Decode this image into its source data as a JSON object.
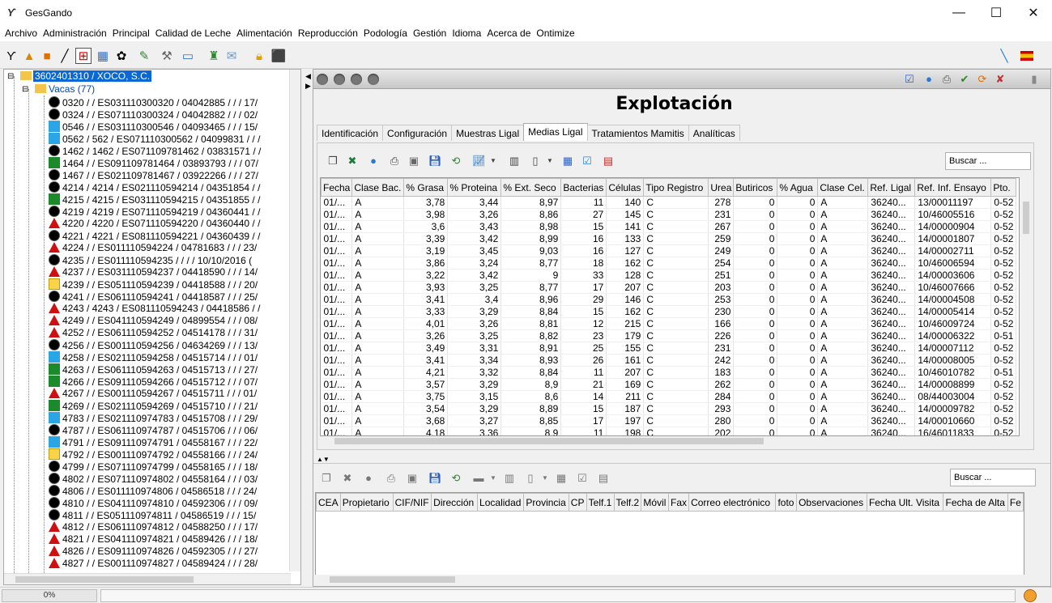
{
  "window": {
    "title": "GesGando",
    "minimize": "—",
    "maximize": "☐",
    "close": "✕"
  },
  "menu": [
    "Archivo",
    "Administración",
    "Principal",
    "Calidad de Leche",
    "Alimentación",
    "Reproducción",
    "Podología",
    "Gestión",
    "Idioma",
    "Acerca de",
    "Ontimize"
  ],
  "tree": {
    "root": "3602401310 / XOCO, S.C.",
    "group": "Vacas (77)",
    "items": [
      {
        "text": "0320 /  /  ES031110300320 / 04042885  /  /  / 17/",
        "icon": "black"
      },
      {
        "text": "0324 /  /  ES071110300324 / 04042882  /  /  / 02/",
        "icon": "black"
      },
      {
        "text": "0546 /  /  ES031110300546 / 04093465  /  /  / 15/",
        "icon": "blue"
      },
      {
        "text": "0562 / 562 / ES071110300562 / 04099831  /  /  / ",
        "icon": "blue"
      },
      {
        "text": "1462 / 1462 / ES071109781462 / 03831571  /  / ",
        "icon": "black"
      },
      {
        "text": "1464 /  /  ES091109781464 / 03893793  /  /  / 07/",
        "icon": "green"
      },
      {
        "text": "1467 /  /  ES021109781467 / 03922266  /  /  / 27/",
        "icon": "black"
      },
      {
        "text": "4214 / 4214 / ES021110594214 / 04351854  /  / ",
        "icon": "black"
      },
      {
        "text": "4215 / 4215 / ES031110594215 / 04351855  /  / ",
        "icon": "green"
      },
      {
        "text": "4219 / 4219 / ES071110594219 / 04360441  /  / ",
        "icon": "black"
      },
      {
        "text": "4220 / 4220 / ES071110594220 / 04360440  /  / ",
        "icon": "red"
      },
      {
        "text": "4221 / 4221 / ES081110594221 / 04360439  /  / ",
        "icon": "black"
      },
      {
        "text": "4224 /  /  ES011110594224 / 04781683  /  /  / 23/",
        "icon": "red"
      },
      {
        "text": "4235 /  /  ES011110594235 /  /  /  / 10/10/2016 (",
        "icon": "black"
      },
      {
        "text": "4237 /  /  ES031110594237 / 04418590  /  /  / 14/",
        "icon": "red"
      },
      {
        "text": "4239 /  /  ES051110594239 / 04418588  /  /  / 20/",
        "icon": "yellow"
      },
      {
        "text": "4241 /  /  ES061110594241 / 04418587  /  /  / 25/",
        "icon": "black"
      },
      {
        "text": "4243 / 4243 / ES081110594243 / 04418586  /  / ",
        "icon": "red"
      },
      {
        "text": "4249 /  /  ES041110594249 / 04899554  /  /  / 08/",
        "icon": "red"
      },
      {
        "text": "4252 /  /  ES061110594252 / 04514178  /  /  / 31/",
        "icon": "red"
      },
      {
        "text": "4256 /  /  ES001110594256 / 04634269  /  /  / 13/",
        "icon": "black"
      },
      {
        "text": "4258 /  /  ES021110594258 / 04515714  /  /  / 01/",
        "icon": "blue"
      },
      {
        "text": "4263 /  /  ES061110594263 / 04515713  /  /  / 27/",
        "icon": "green"
      },
      {
        "text": "4266 /  /  ES091110594266 / 04515712  /  /  / 07/",
        "icon": "green"
      },
      {
        "text": "4267 /  /  ES001110594267 / 04515711  /  /  / 01/",
        "icon": "red"
      },
      {
        "text": "4269 /  /  ES021110594269 / 04515710  /  /  / 21/",
        "icon": "green"
      },
      {
        "text": "4783 /  /  ES021110974783 / 04515708  /  /  / 29/",
        "icon": "blue"
      },
      {
        "text": "4787 /  /  ES061110974787 / 04515706  /  /  / 06/",
        "icon": "black"
      },
      {
        "text": "4791 /  /  ES091110974791 / 04558167  /  /  / 22/",
        "icon": "blue"
      },
      {
        "text": "4792 /  /  ES001110974792 / 04558166  /  /  / 24/",
        "icon": "yellow"
      },
      {
        "text": "4799 /  /  ES071110974799 / 04558165  /  /  / 18/",
        "icon": "black"
      },
      {
        "text": "4802 /  /  ES071110974802 / 04558164  /  /  / 03/",
        "icon": "black"
      },
      {
        "text": "4806 /  /  ES011110974806 / 04586518  /  /  / 24/",
        "icon": "black"
      },
      {
        "text": "4810 /  /  ES041110974810 / 04592306  /  /  / 09/",
        "icon": "black"
      },
      {
        "text": "4811 /  /  ES051110974811 / 04586519  /  /  / 15/",
        "icon": "black"
      },
      {
        "text": "4812 /  /  ES061110974812 / 04588250  /  /  / 17/",
        "icon": "red"
      },
      {
        "text": "4821 /  /  ES041110974821 / 04589426  /  /  / 18/",
        "icon": "red"
      },
      {
        "text": "4826 /  /  ES091110974826 / 04592305  /  /  / 27/",
        "icon": "red"
      },
      {
        "text": "4827 /  /  ES001110974827 / 04589424  /  /  / 28/",
        "icon": "red"
      }
    ]
  },
  "form": {
    "title": "Explotación",
    "tabs": [
      "Identificación",
      "Configuración",
      "Muestras Ligal",
      "Medias Ligal",
      "Tratamientos Mamitis",
      "Analíticas"
    ],
    "active_tab": 3,
    "search_placeholder": "Buscar ...",
    "search2_placeholder": "Buscar ..."
  },
  "grid1": {
    "columns": [
      "Fecha",
      "Clase Bac.",
      "% Grasa",
      "% Proteina",
      "% Ext. Seco",
      "Bacterias",
      "Células",
      "Tipo Registro",
      "Urea",
      "Butiricos",
      "% Agua",
      "Clase Cel.",
      "Ref. Ligal",
      "Ref. Inf. Ensayo",
      "Pto."
    ],
    "rows": [
      [
        "01/...",
        "A",
        "3,78",
        "3,44",
        "8,97",
        "11",
        "140",
        "C",
        "278",
        "0",
        "0",
        "A",
        "36240...",
        "13/00011197",
        "0-52"
      ],
      [
        "01/...",
        "A",
        "3,98",
        "3,26",
        "8,86",
        "27",
        "145",
        "C",
        "231",
        "0",
        "0",
        "A",
        "36240...",
        "10/46005516",
        "0-52"
      ],
      [
        "01/...",
        "A",
        "3,6",
        "3,43",
        "8,98",
        "15",
        "141",
        "C",
        "267",
        "0",
        "0",
        "A",
        "36240...",
        "14/00000904",
        "0-52"
      ],
      [
        "01/...",
        "A",
        "3,39",
        "3,42",
        "8,99",
        "16",
        "133",
        "C",
        "259",
        "0",
        "0",
        "A",
        "36240...",
        "14/00001807",
        "0-52"
      ],
      [
        "01/...",
        "A",
        "3,19",
        "3,45",
        "9,03",
        "16",
        "127",
        "C",
        "249",
        "0",
        "0",
        "A",
        "36240...",
        "14/00002711",
        "0-52"
      ],
      [
        "01/...",
        "A",
        "3,86",
        "3,24",
        "8,77",
        "18",
        "162",
        "C",
        "254",
        "0",
        "0",
        "A",
        "36240...",
        "10/46006594",
        "0-52"
      ],
      [
        "01/...",
        "A",
        "3,22",
        "3,42",
        "9",
        "33",
        "128",
        "C",
        "251",
        "0",
        "0",
        "A",
        "36240...",
        "14/00003606",
        "0-52"
      ],
      [
        "01/...",
        "A",
        "3,93",
        "3,25",
        "8,77",
        "17",
        "207",
        "C",
        "203",
        "0",
        "0",
        "A",
        "36240...",
        "10/46007666",
        "0-52"
      ],
      [
        "01/...",
        "A",
        "3,41",
        "3,4",
        "8,96",
        "29",
        "146",
        "C",
        "253",
        "0",
        "0",
        "A",
        "36240...",
        "14/00004508",
        "0-52"
      ],
      [
        "01/...",
        "A",
        "3,33",
        "3,29",
        "8,84",
        "15",
        "162",
        "C",
        "230",
        "0",
        "0",
        "A",
        "36240...",
        "14/00005414",
        "0-52"
      ],
      [
        "01/...",
        "A",
        "4,01",
        "3,26",
        "8,81",
        "12",
        "215",
        "C",
        "166",
        "0",
        "0",
        "A",
        "36240...",
        "10/46009724",
        "0-52"
      ],
      [
        "01/...",
        "A",
        "3,26",
        "3,25",
        "8,82",
        "23",
        "179",
        "C",
        "226",
        "0",
        "0",
        "A",
        "36240...",
        "14/00006322",
        "0-51"
      ],
      [
        "01/...",
        "A",
        "3,49",
        "3,31",
        "8,91",
        "25",
        "155",
        "C",
        "231",
        "0",
        "0",
        "A",
        "36240...",
        "14/00007112",
        "0-52"
      ],
      [
        "01/...",
        "A",
        "3,41",
        "3,34",
        "8,93",
        "26",
        "161",
        "C",
        "242",
        "0",
        "0",
        "A",
        "36240...",
        "14/00008005",
        "0-52"
      ],
      [
        "01/...",
        "A",
        "4,21",
        "3,32",
        "8,84",
        "11",
        "207",
        "C",
        "183",
        "0",
        "0",
        "A",
        "36240...",
        "10/46010782",
        "0-51"
      ],
      [
        "01/...",
        "A",
        "3,57",
        "3,29",
        "8,9",
        "21",
        "169",
        "C",
        "262",
        "0",
        "0",
        "A",
        "36240...",
        "14/00008899",
        "0-52"
      ],
      [
        "01/...",
        "A",
        "3,75",
        "3,15",
        "8,6",
        "14",
        "211",
        "C",
        "284",
        "0",
        "0",
        "A",
        "36240...",
        "08/44003004",
        "0-52"
      ],
      [
        "01/...",
        "A",
        "3,54",
        "3,29",
        "8,89",
        "15",
        "187",
        "C",
        "293",
        "0",
        "0",
        "A",
        "36240...",
        "14/00009782",
        "0-52"
      ],
      [
        "01/...",
        "A",
        "3,68",
        "3,27",
        "8,85",
        "17",
        "197",
        "C",
        "280",
        "0",
        "0",
        "A",
        "36240...",
        "14/00010660",
        "0-52"
      ],
      [
        "01/...",
        "A",
        "4,18",
        "3,36",
        "8,9",
        "11",
        "198",
        "C",
        "202",
        "0",
        "0",
        "A",
        "36240...",
        "16/46011833",
        "0-52"
      ]
    ]
  },
  "grid2": {
    "columns": [
      "CEA",
      "Propietario",
      "CIF/NIF",
      "Dirección",
      "Localidad",
      "Provincia",
      "CP",
      "Telf.1",
      "Telf.2",
      "Móvil",
      "Fax",
      "Correo electrónico",
      "foto",
      "Observaciones",
      "Fecha Ult. Visita",
      "Fecha de Alta",
      "Fe"
    ]
  },
  "status": {
    "progress": "0%"
  },
  "icon_colors": {
    "black": "#000000",
    "blue": "#2aa6e6",
    "green": "#1a8a2a",
    "red": "#d01010",
    "yellow": "#f7d44a"
  }
}
